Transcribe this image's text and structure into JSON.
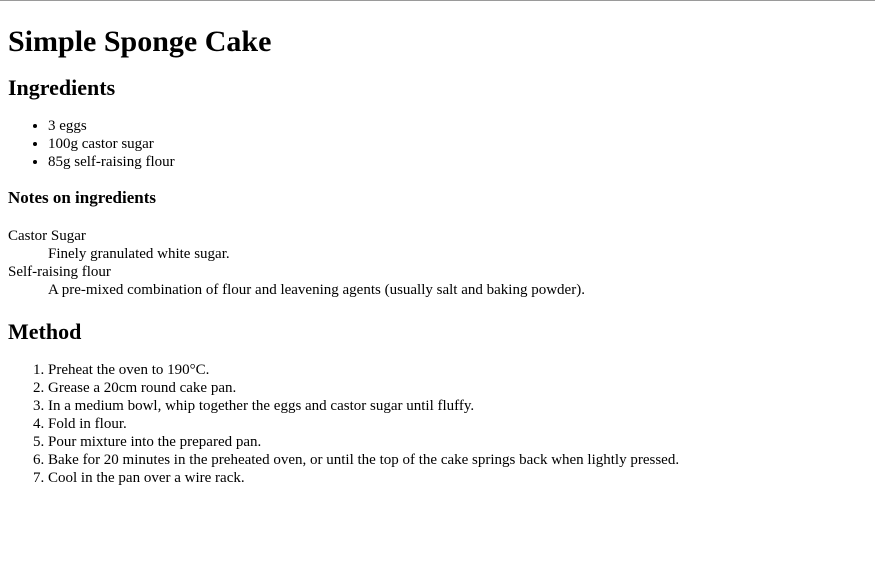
{
  "title": "Simple Sponge Cake",
  "ingredients": {
    "heading": "Ingredients",
    "items": [
      "3 eggs",
      "100g castor sugar",
      "85g self-raising flour"
    ]
  },
  "notes": {
    "heading": "Notes on ingredients",
    "terms": [
      {
        "term": "Castor Sugar",
        "definition": "Finely granulated white sugar."
      },
      {
        "term": "Self-raising flour",
        "definition": "A pre-mixed combination of flour and leavening agents (usually salt and baking powder)."
      }
    ]
  },
  "method": {
    "heading": "Method",
    "steps": [
      "Preheat the oven to 190°C.",
      "Grease a 20cm round cake pan.",
      "In a medium bowl, whip together the eggs and castor sugar until fluffy.",
      "Fold in flour.",
      "Pour mixture into the prepared pan.",
      "Bake for 20 minutes in the preheated oven, or until the top of the cake springs back when lightly pressed.",
      "Cool in the pan over a wire rack."
    ]
  }
}
